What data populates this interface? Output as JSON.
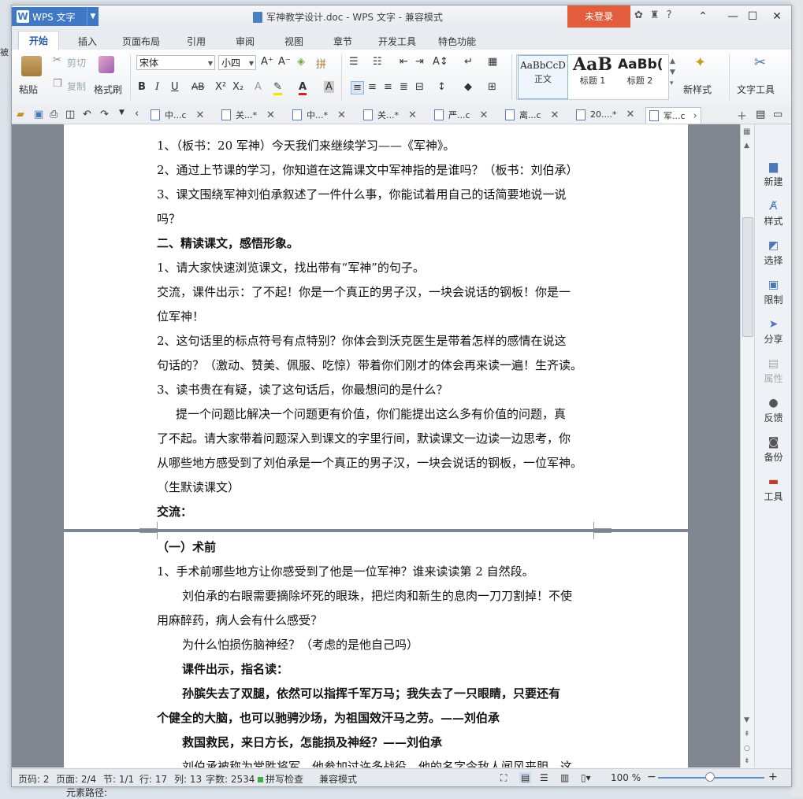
{
  "app": {
    "name": "WPS 文字",
    "logo": "W"
  },
  "window_title": "军神教学设计.doc - WPS 文字 - 兼容模式",
  "title_bar": {
    "login_label": "未登录",
    "help_label": "?"
  },
  "menu_tabs": [
    "开始",
    "插入",
    "页面布局",
    "引用",
    "审阅",
    "视图",
    "章节",
    "开发工具",
    "特色功能"
  ],
  "ribbon": {
    "paste": "粘贴",
    "cut": "剪切",
    "copy": "复制",
    "format_painter": "格式刷",
    "font_name": "宋体",
    "font_size": "小四",
    "styles": [
      {
        "sample": "AaBbCcD",
        "label": "正文"
      },
      {
        "sample": "AaB",
        "label": "标题 1"
      },
      {
        "sample": "AaBb(",
        "label": "标题 2"
      }
    ],
    "new_style": "新样式",
    "text_tools": "文字工具"
  },
  "doc_tabs": [
    "中...c",
    "关...*",
    "中...*",
    "关...*",
    "严...c",
    "离...c",
    "20....*",
    "军...c"
  ],
  "document": {
    "page1": [
      "1、（板书：20 军神）今天我们来继续学习——《军神》。",
      "2、通过上节课的学习，你知道在这篇课文中军神指的是谁吗？（板书：刘伯承）",
      "3、课文围绕军神刘伯承叙述了一件什么事，你能试着用自己的话简要地说一说",
      "吗？",
      "二、精读课文，感悟形象。",
      "1、请大家快速浏览课文，找出带有“军神”的句子。",
      "交流，课件出示：了不起！你是一个真正的男子汉，一块会说话的钢板！你是一",
      "位军神！",
      "2、这句话里的标点符号有点特别？你体会到沃克医生是带着怎样的感情在说这",
      "句话的？（激动、赞美、佩服、吃惊）带着你们刚才的体会再来读一遍！生齐读。",
      "3、读书贵在有疑，读了这句话后，你最想问的是什么？",
      "提一个问题比解决一个问题更有价值，你们能提出这么多有价值的问题，真",
      "了不起。请大家带着问题深入到课文的字里行间，默读课文一边读一边思考，你",
      "从哪些地方感受到了刘伯承是一个真正的男子汉，一块会说话的钢板，一位军神。",
      "（生默读课文）",
      "交流："
    ],
    "page2": [
      "（一）术前",
      "1、手术前哪些地方让你感受到了他是一位军神？谁来读读第 2 自然段。",
      "刘伯承的右眼需要摘除坏死的眼珠，把烂肉和新生的息肉一刀刀割掉！不使",
      "用麻醉药，病人会有什么感受？",
      "为什么怕损伤脑神经？（考虑的是他自己吗）",
      "课件出示，指名读：",
      "孙膑失去了双腿，依然可以指挥千军万马；我失去了一只眼睛，只要还有",
      "个健全的大脑，也可以驰骋沙场，为祖国效汗马之劳。——刘伯承",
      "救国救民，来日方长，怎能损及神经？——刘伯承",
      "刘伯承被称为常胜将军，他参加过许多战役，他的名字令敌人闻风丧胆，这"
    ]
  },
  "sidebar": [
    {
      "label": "新建",
      "icon": "new-doc-icon"
    },
    {
      "label": "样式",
      "icon": "style-icon"
    },
    {
      "label": "选择",
      "icon": "select-icon"
    },
    {
      "label": "限制",
      "icon": "lock-icon"
    },
    {
      "label": "分享",
      "icon": "share-icon"
    },
    {
      "label": "属性",
      "icon": "properties-icon"
    },
    {
      "label": "反馈",
      "icon": "feedback-icon"
    },
    {
      "label": "备份",
      "icon": "backup-icon"
    },
    {
      "label": "工具",
      "icon": "toolbox-icon"
    }
  ],
  "status": {
    "page_num": "页码: 2",
    "pages": "页面: 2/4",
    "section": "节: 1/1",
    "row": "行: 17",
    "col": "列: 13",
    "word_count": "字数: 2534",
    "spell_check": "拼写检查",
    "compat_mode": "兼容模式",
    "zoom": "100 %"
  },
  "outside": {
    "element_path": "元素路径:",
    "left_clip": "被"
  },
  "colors": {
    "accent": "#3f79c6",
    "login": "#e35d3c"
  }
}
